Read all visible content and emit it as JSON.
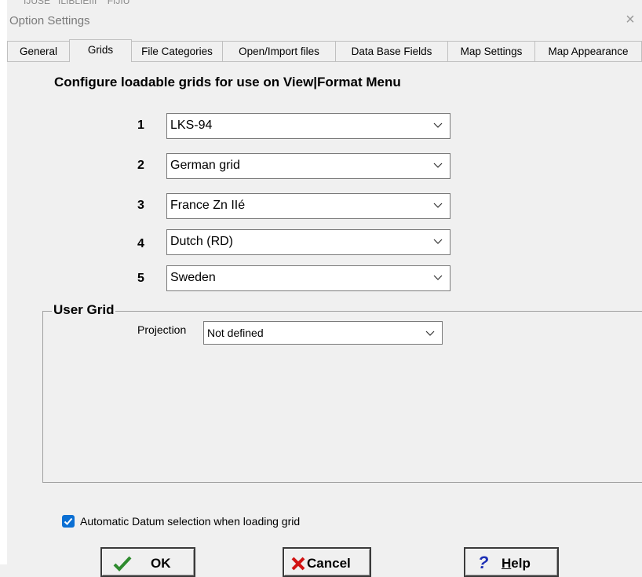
{
  "window": {
    "menu_remnant": "IJUSE   ILIBLIEIII    FIJIU",
    "title": "Option Settings",
    "close_label": "×"
  },
  "tabs": [
    {
      "label": "General",
      "active": false
    },
    {
      "label": "Grids",
      "active": true
    },
    {
      "label": "File Categories",
      "active": false
    },
    {
      "label": "Open/Import files",
      "active": false
    },
    {
      "label": "Data Base Fields",
      "active": false
    },
    {
      "label": "Map Settings",
      "active": false
    },
    {
      "label": "Map Appearance",
      "active": false
    }
  ],
  "grids": {
    "heading": "Configure loadable grids  for use on View|Format Menu",
    "rows": [
      {
        "number": "1",
        "value": "LKS-94"
      },
      {
        "number": "2",
        "value": "German grid"
      },
      {
        "number": "3",
        "value": "France Zn IIé"
      },
      {
        "number": "4",
        "value": "Dutch (RD)"
      },
      {
        "number": "5",
        "value": "Sweden"
      }
    ]
  },
  "user_grid": {
    "legend": "User Grid",
    "projection_label": "Projection",
    "projection_value": "Not defined"
  },
  "auto_datum": {
    "label": "Automatic Datum selection when loading grid",
    "checked": true
  },
  "buttons": {
    "ok": "OK",
    "cancel": "Cancel",
    "help_first": "H",
    "help_rest": "elp"
  },
  "colors": {
    "checkbox": "#0b6fd3",
    "ok_icon": "#2e8b2e",
    "cancel_icon": "#d11414",
    "help_icon": "#1c2fb5"
  }
}
